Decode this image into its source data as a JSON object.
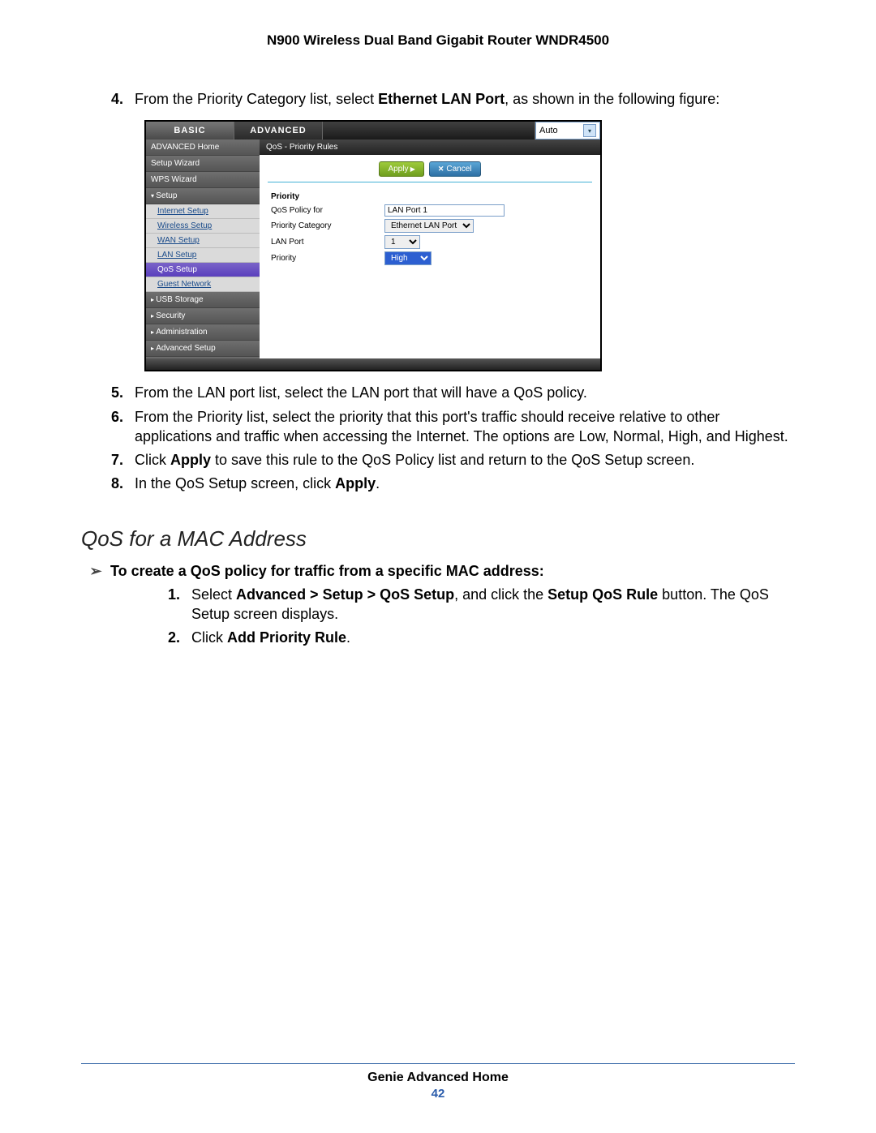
{
  "doc": {
    "header_title": "N900 Wireless Dual Band Gigabit Router WNDR4500",
    "footer_title": "Genie Advanced Home",
    "page_number": "42"
  },
  "steps_before": [
    {
      "n": "4.",
      "pre": "From the Priority Category list, select ",
      "bold": "Ethernet LAN Port",
      "post": ", as shown in the following figure:"
    }
  ],
  "steps_after": [
    {
      "n": "5.",
      "text": "From the LAN port list, select the LAN port that will have a QoS policy."
    },
    {
      "n": "6.",
      "text": "From the Priority list, select the priority that this port's traffic should receive relative to other applications and traffic when accessing the Internet. The options are Low, Normal, High, and Highest."
    },
    {
      "n": "7.",
      "pre": "Click ",
      "bold": "Apply",
      "post": " to save this rule to the QoS Policy list and return to the QoS Setup screen."
    },
    {
      "n": "8.",
      "pre": "In the QoS Setup screen, click ",
      "bold": "Apply",
      "post": "."
    }
  ],
  "section_heading": "QoS for a MAC Address",
  "task_line": "To create a QoS policy for traffic from a specific MAC address:",
  "sub_steps": [
    {
      "n": "1.",
      "pre": "Select ",
      "bold": "Advanced > Setup > QoS Setup",
      "mid": ", and click the ",
      "bold2": "Setup QoS Rule",
      "post": " button. The QoS Setup screen displays."
    },
    {
      "n": "2.",
      "pre": "Click ",
      "bold": "Add Priority Rule",
      "post": "."
    }
  ],
  "router": {
    "tab_basic": "BASIC",
    "tab_advanced": "ADVANCED",
    "auto_label": "Auto",
    "sidebar": {
      "adv_home": "ADVANCED Home",
      "setup_wizard": "Setup Wizard",
      "wps_wizard": "WPS Wizard",
      "setup": "Setup",
      "internet_setup": "Internet Setup",
      "wireless_setup": "Wireless Setup",
      "wan_setup": "WAN Setup",
      "lan_setup": "LAN Setup",
      "qos_setup": "QoS Setup",
      "guest_network": "Guest Network",
      "usb": "USB Storage",
      "security": "Security",
      "admin": "Administration",
      "adv_setup": "Advanced Setup"
    },
    "panel_title": "QoS - Priority Rules",
    "btn_apply": "Apply",
    "btn_cancel": "Cancel",
    "form": {
      "priority_hd": "Priority",
      "policy_for_lbl": "QoS Policy for",
      "policy_for_val": "LAN Port 1",
      "category_lbl": "Priority Category",
      "category_val": "Ethernet LAN Port",
      "lanport_lbl": "LAN Port",
      "lanport_val": "1",
      "priority_lbl": "Priority",
      "priority_val": "High"
    }
  }
}
